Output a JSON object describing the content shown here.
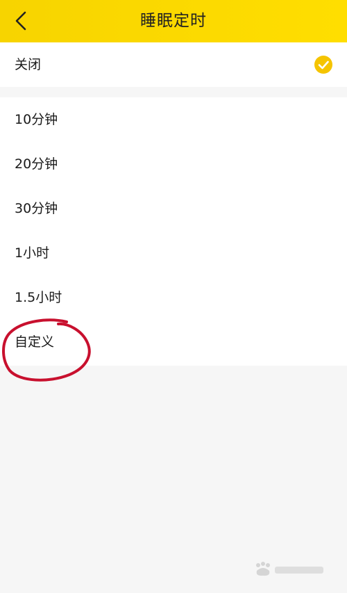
{
  "header": {
    "title": "睡眠定时",
    "back_icon": "chevron-left-icon"
  },
  "options": [
    {
      "label": "关闭",
      "selected": true
    },
    {
      "label": "10分钟",
      "selected": false
    },
    {
      "label": "20分钟",
      "selected": false
    },
    {
      "label": "30分钟",
      "selected": false
    },
    {
      "label": "1小时",
      "selected": false
    },
    {
      "label": "1.5小时",
      "selected": false
    },
    {
      "label": "自定义",
      "selected": false
    }
  ],
  "colors": {
    "header_yellow": "#ffdd00",
    "check_yellow": "#f5c400",
    "annotation_red": "#c8102e",
    "background": "#f6f6f6"
  },
  "selected_icon": "check-circle-icon",
  "annotation": "red-circle-around-custom-option"
}
